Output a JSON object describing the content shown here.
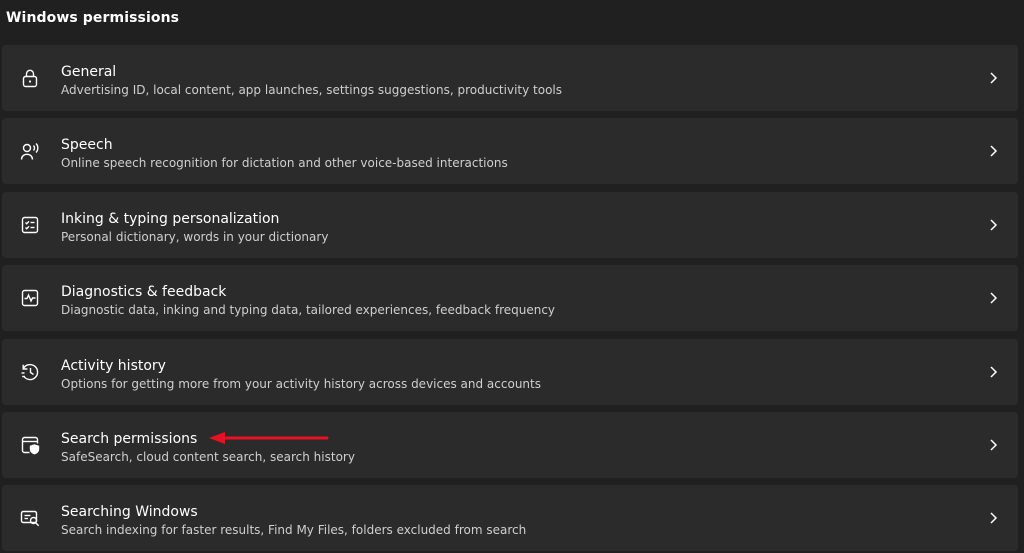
{
  "section_title": "Windows permissions",
  "accent_color": "#e81123",
  "items": [
    {
      "title": "General",
      "subtitle": "Advertising ID, local content, app launches, settings suggestions, productivity tools",
      "icon": "lock-icon"
    },
    {
      "title": "Speech",
      "subtitle": "Online speech recognition for dictation and other voice-based interactions",
      "icon": "speech-icon"
    },
    {
      "title": "Inking & typing personalization",
      "subtitle": "Personal dictionary, words in your dictionary",
      "icon": "dictionary-icon"
    },
    {
      "title": "Diagnostics & feedback",
      "subtitle": "Diagnostic data, inking and typing data, tailored experiences, feedback frequency",
      "icon": "diagnostics-icon"
    },
    {
      "title": "Activity history",
      "subtitle": "Options for getting more from your activity history across devices and accounts",
      "icon": "history-icon"
    },
    {
      "title": "Search permissions",
      "subtitle": "SafeSearch, cloud content search, search history",
      "icon": "search-shield-icon"
    },
    {
      "title": "Searching Windows",
      "subtitle": "Search indexing for faster results, Find My Files, folders excluded from search",
      "icon": "search-windows-icon"
    }
  ]
}
